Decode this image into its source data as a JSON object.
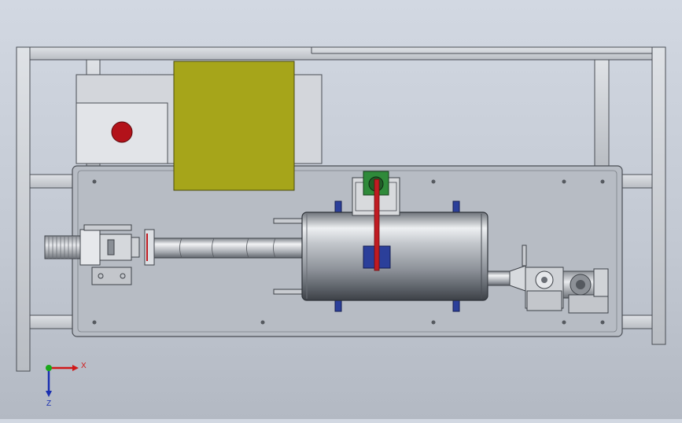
{
  "view": {
    "background_top": "#d2d8e2",
    "background_bottom": "#b3b9c3"
  },
  "colors": {
    "frame": "#c9ccd1",
    "frame_edge": "#4a4e55",
    "base_plate": "#b7bcc4",
    "yellow_cover": "#a6a51a",
    "red_button": "#b3121a",
    "green_bracket": "#2f8a3a",
    "blue_block": "#2b3f9a",
    "red_belt": "#c01b22",
    "axis_x": "#d01818",
    "axis_y": "#1aa81a",
    "axis_z": "#1a2fb0"
  },
  "triad": {
    "x_label": "X",
    "y_label": "",
    "z_label": "Z"
  },
  "components": [
    "frame",
    "control-box",
    "yellow-cover",
    "base-plate",
    "left-motor",
    "shaft-tube",
    "drum",
    "belt-drive",
    "right-gear-motor"
  ]
}
